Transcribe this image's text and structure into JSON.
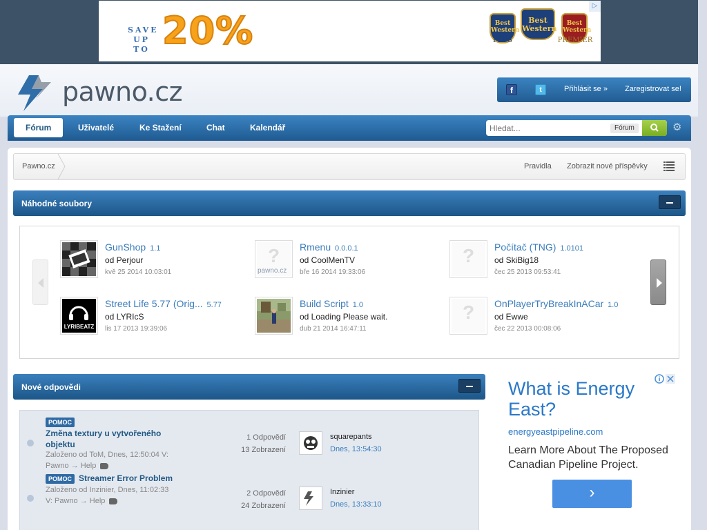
{
  "ad_banner": {
    "save_text": "SAVE UP TO",
    "percent": "20%",
    "brand_logo": "Best Western",
    "sub_left": "PLUS",
    "sub_right": "PREMIER"
  },
  "header": {
    "logo_text": "pawno.cz",
    "login": "Přihlásit se »",
    "register": "Zaregistrovat se!"
  },
  "nav": {
    "tabs": [
      {
        "label": "Fórum",
        "active": true
      },
      {
        "label": "Uživatelé"
      },
      {
        "label": "Ke Stažení"
      },
      {
        "label": "Chat"
      },
      {
        "label": "Kalendář"
      }
    ],
    "search_placeholder": "Hledat...",
    "search_scope": "Fórum"
  },
  "breadcrumb": {
    "home": "Pawno.cz",
    "rules": "Pravidla",
    "new_posts": "Zobrazit nové příspěvky"
  },
  "random_files": {
    "title": "Náhodné soubory",
    "items": [
      {
        "name": "GunShop",
        "ver": "1.1",
        "by": "od Perjour",
        "date": "kvě 25 2014 10:03:01"
      },
      {
        "name": "Rmenu",
        "ver": "0.0.0.1",
        "by": "od CoolMenTV",
        "date": "bře 16 2014 19:33:06"
      },
      {
        "name": "Počítač (TNG)",
        "ver": "1.0101",
        "by": "od SkiBig18",
        "date": "čec 25 2013 09:53:41"
      },
      {
        "name": "Street Life 5.77 (Orig...",
        "ver": "5.77",
        "by": "od LYRIcS",
        "date": "lis 17 2013 19:39:06"
      },
      {
        "name": "Build Script",
        "ver": "1.0",
        "by": "od Loading Please wait.",
        "date": "dub 21 2014 16:47:11"
      },
      {
        "name": "OnPlayerTryBreakInACar",
        "ver": "1.0",
        "by": "od Ewwe",
        "date": "čec 22 2013 00:08:06"
      }
    ],
    "thumb_text": {
      "rmenu": "pawno.cz",
      "lyrics": "LYRIBEATZ"
    }
  },
  "new_replies": {
    "title": "Nové odpovědi",
    "topics": [
      {
        "badge": "POMOC",
        "title_line1": "Změna textury u vytvořeného",
        "title_line2": "objektu",
        "meta_line1": "Založeno od ToM, Dnes, 12:50:04 V:",
        "meta_line2": "Pawno → Help",
        "replies": "1 Odpovědí",
        "views": "13 Zobrazení",
        "last_user": "squarepants",
        "last_date": "Dnes, 13:54:30"
      },
      {
        "badge": "POMOC",
        "title_line1": "Streamer Error Problem",
        "meta_line1": "Založeno od Inzinier, Dnes, 11:02:33",
        "meta_line2": "V: Pawno → Help",
        "replies": "2 Odpovědí",
        "views": "24 Zobrazení",
        "last_user": "Inzinier",
        "last_date": "Dnes, 13:33:10"
      }
    ]
  },
  "side_ad": {
    "headline": "What is Energy East?",
    "url": "energyeastpipeline.com",
    "body": "Learn More About The Proposed Canadian Pipeline Project.",
    "button": "›"
  },
  "icons": {
    "search": "search-icon",
    "gear": "gear-icon",
    "facebook": "facebook-icon",
    "twitter": "twitter-icon"
  },
  "colors": {
    "accent": "#225985",
    "nav_blue": "#2f6ea8",
    "link_blue": "#3b7dbb",
    "search_green": "#8cbe32"
  }
}
